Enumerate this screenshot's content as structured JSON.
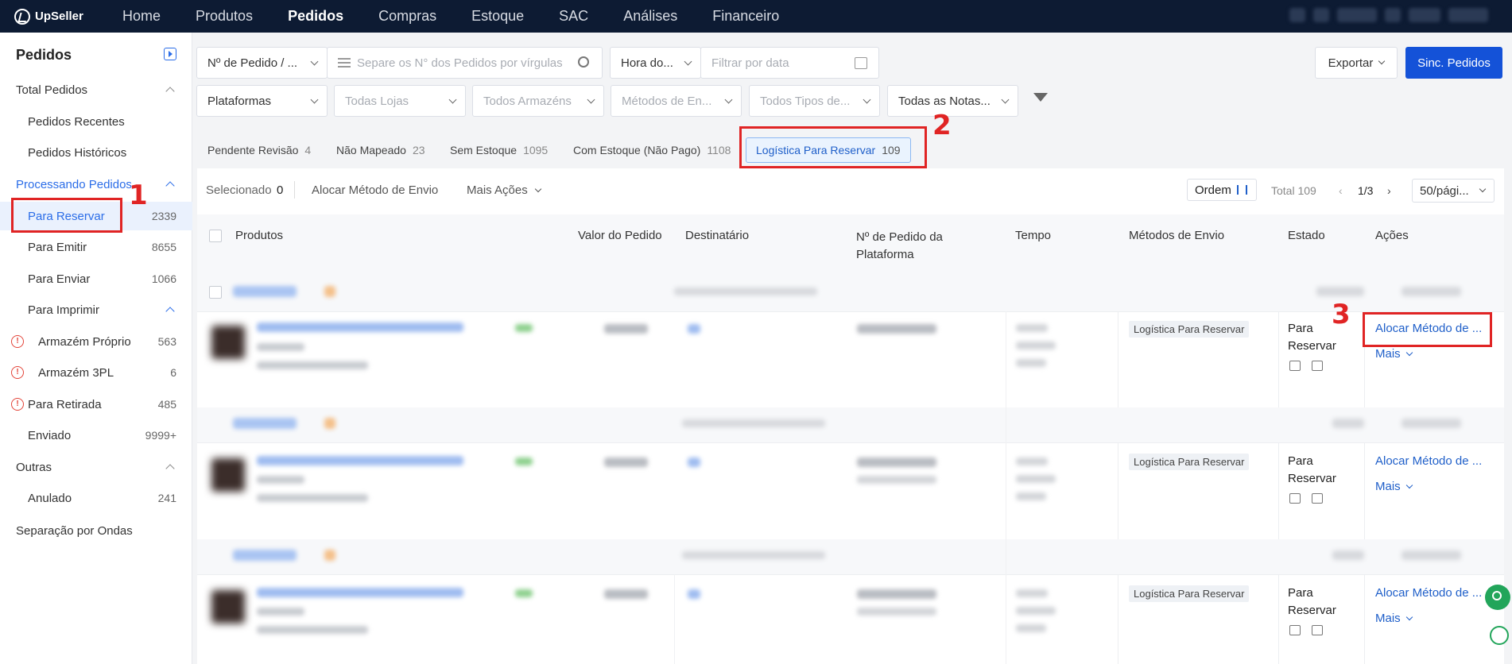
{
  "topnav": {
    "logo": "UpSeller",
    "items": [
      "Home",
      "Produtos",
      "Pedidos",
      "Compras",
      "Estoque",
      "SAC",
      "Análises",
      "Financeiro"
    ],
    "active": "Pedidos"
  },
  "sidebar": {
    "title": "Pedidos",
    "sections": {
      "total": "Total Pedidos",
      "recentes": "Pedidos Recentes",
      "historicos": "Pedidos Históricos",
      "processando": "Processando Pedidos",
      "para_reservar": {
        "label": "Para Reservar",
        "count": "2339"
      },
      "para_emitir": {
        "label": "Para Emitir",
        "count": "8655"
      },
      "para_enviar": {
        "label": "Para Enviar",
        "count": "1066"
      },
      "para_imprimir": "Para Imprimir",
      "armazem_proprio": {
        "label": "Armazém Próprio",
        "count": "563"
      },
      "armazem_3pl": {
        "label": "Armazém 3PL",
        "count": "6"
      },
      "para_retirada": {
        "label": "Para Retirada",
        "count": "485"
      },
      "enviado": {
        "label": "Enviado",
        "count": "9999+"
      },
      "outras": "Outras",
      "anulado": {
        "label": "Anulado",
        "count": "241"
      },
      "ondas": "Separação por Ondas"
    }
  },
  "filters": {
    "order_type": "Nº de Pedido / ...",
    "search_placeholder": "Separe os N° dos Pedidos por vírgulas",
    "time": "Hora do...",
    "date_placeholder": "Filtrar por data",
    "plataformas": "Plataformas",
    "lojas": "Todas Lojas",
    "armazens": "Todos Armazéns",
    "metodos": "Métodos de En...",
    "tipos": "Todos Tipos de...",
    "notas": "Todas as Notas...",
    "exportar": "Exportar",
    "sinc": "Sinc. Pedidos"
  },
  "tabs": [
    {
      "label": "Pendente Revisão",
      "count": "4"
    },
    {
      "label": "Não Mapeado",
      "count": "23"
    },
    {
      "label": "Sem Estoque",
      "count": "1095"
    },
    {
      "label": "Com Estoque (Não Pago)",
      "count": "1108"
    },
    {
      "label": "Logística Para Reservar",
      "count": "109"
    }
  ],
  "toolbar": {
    "selecionado": "Selecionado",
    "selecionado_count": "0",
    "alocar": "Alocar Método de Envio",
    "mais_acoes": "Mais Ações",
    "ordem": "Ordem",
    "total": "Total 109",
    "page": "1/3",
    "per_page": "50/pági..."
  },
  "columns": {
    "produtos": "Produtos",
    "valor": "Valor do Pedido",
    "destinatario": "Destinatário",
    "nr_pedido": "Nº de Pedido da Plataforma",
    "tempo": "Tempo",
    "metodos": "Métodos de Envio",
    "estado": "Estado",
    "acoes": "Ações"
  },
  "rows": [
    {
      "metodo": "Logística Para Reservar",
      "estado": "Para Reservar",
      "acao": "Alocar Método de ...",
      "mais": "Mais"
    },
    {
      "metodo": "Logística Para Reservar",
      "estado": "Para Reservar",
      "acao": "Alocar Método de ...",
      "mais": "Mais"
    },
    {
      "metodo": "Logística Para Reservar",
      "estado": "Para Reservar",
      "acao": "Alocar Método de ...",
      "mais": "Mais"
    }
  ],
  "annotations": [
    "1",
    "2",
    "3"
  ],
  "colors": {
    "primary": "#1f5fc9",
    "nav": "#0d1b33",
    "annotation": "#e02424"
  }
}
